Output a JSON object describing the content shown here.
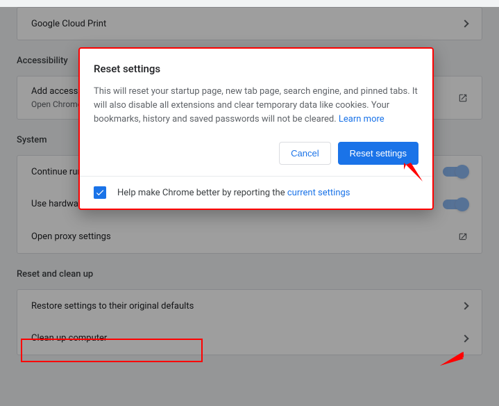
{
  "rows": {
    "google_cloud_print": "Google Cloud Print",
    "add_accessibility": "Add accessibility features",
    "add_accessibility_sub": "Open Chrome Web Store",
    "continue_running": "Continue running background apps when Google Chrome is closed",
    "hardware_accel": "Use hardware acceleration when available",
    "open_proxy": "Open proxy settings",
    "restore_settings": "Restore settings to their original defaults",
    "clean_up": "Clean up computer"
  },
  "sections": {
    "accessibility": "Accessibility",
    "system": "System",
    "reset": "Reset and clean up"
  },
  "dialog": {
    "title": "Reset settings",
    "body": "This will reset your startup page, new tab page, search engine, and pinned tabs. It will also disable all extensions and clear temporary data like cookies. Your bookmarks, history and saved passwords will not be cleared. ",
    "learn_more": "Learn more",
    "cancel": "Cancel",
    "confirm": "Reset settings",
    "footer_prefix": "Help make Chrome better by reporting the ",
    "footer_link": "current settings"
  }
}
